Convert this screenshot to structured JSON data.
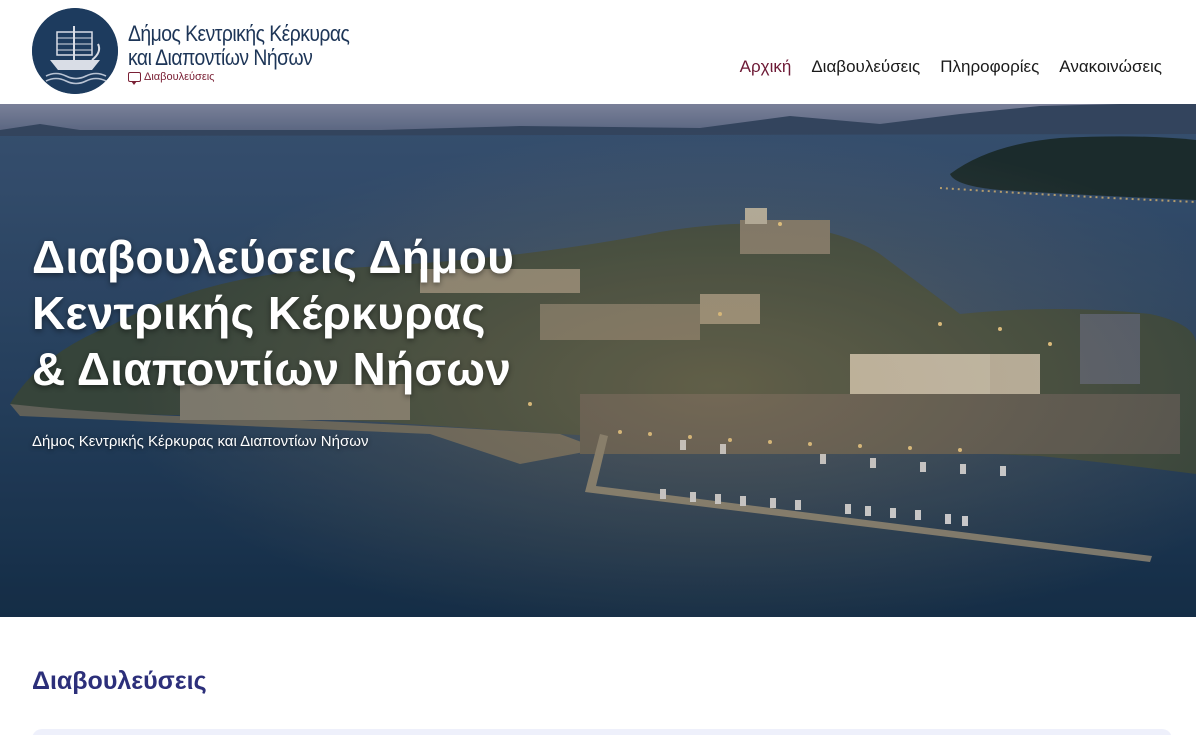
{
  "header": {
    "logo_line1": "Δήμος Κεντρικής Κέρκυρας",
    "logo_line2": "και Διαποντίων Νήσων",
    "logo_sub": "Διαβουλεύσεις",
    "nav": [
      {
        "label": "Αρχική",
        "active": true
      },
      {
        "label": "Διαβουλεύσεις",
        "active": false
      },
      {
        "label": "Πληροφορίες",
        "active": false
      },
      {
        "label": "Ανακοινώσεις",
        "active": false
      }
    ]
  },
  "hero": {
    "title_lines": [
      "Διαβουλεύσεις Δήμου",
      "Κεντρικής Κέρκυρας",
      "& Διαποντίων Νήσων"
    ],
    "subtitle": "Δήμος Κεντρικής Κέρκυρας και Διαποντίων Νήσων",
    "background": "aerial-photo-corfu-old-fortress-marina-dusk"
  },
  "section": {
    "title": "Διαβουλεύσεις"
  },
  "colors": {
    "brand_navy": "#1d3557",
    "accent_burgundy": "#6d1a36",
    "section_title": "#2c2f7a",
    "card_bg": "#eef0fb"
  }
}
